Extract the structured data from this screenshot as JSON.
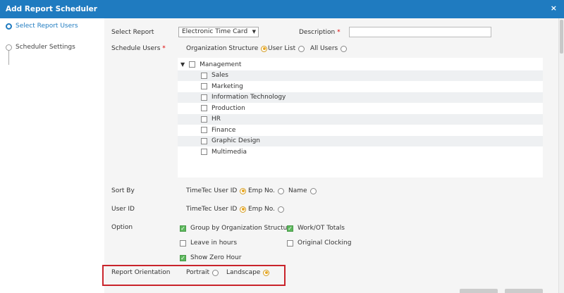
{
  "dialog": {
    "title": "Add Report Scheduler",
    "close": "×"
  },
  "steps": [
    {
      "label": "Select Report Users",
      "active": true
    },
    {
      "label": "Scheduler Settings",
      "active": false
    }
  ],
  "form": {
    "select_report": {
      "label": "Select Report",
      "value": "Electronic Time Card"
    },
    "description": {
      "label": "Description",
      "required_mark": "*",
      "value": ""
    },
    "schedule_users": {
      "label": "Schedule Users",
      "required_mark": "*",
      "options": [
        {
          "label": "Organization Structure",
          "selected": true
        },
        {
          "label": "User List",
          "selected": false
        },
        {
          "label": "All Users",
          "selected": false
        }
      ]
    },
    "tree": {
      "root": {
        "label": "Management",
        "checked": false
      },
      "children": [
        {
          "label": "Sales",
          "checked": false
        },
        {
          "label": "Marketing",
          "checked": false
        },
        {
          "label": "Information Technology",
          "checked": false
        },
        {
          "label": "Production",
          "checked": false
        },
        {
          "label": "HR",
          "checked": false
        },
        {
          "label": "Finance",
          "checked": false
        },
        {
          "label": "Graphic Design",
          "checked": false
        },
        {
          "label": "Multimedia",
          "checked": false
        }
      ]
    },
    "sort_by": {
      "label": "Sort By",
      "options": [
        {
          "label": "TimeTec User ID",
          "selected": true
        },
        {
          "label": "Emp No.",
          "selected": false
        },
        {
          "label": "Name",
          "selected": false
        }
      ]
    },
    "user_id": {
      "label": "User ID",
      "options": [
        {
          "label": "TimeTec User ID",
          "selected": true
        },
        {
          "label": "Emp No.",
          "selected": false
        }
      ]
    },
    "option": {
      "label": "Option",
      "items": [
        {
          "label": "Group by Organization Structure",
          "checked": true
        },
        {
          "label": "Work/OT Totals",
          "checked": true
        },
        {
          "label": "Leave in hours",
          "checked": false
        },
        {
          "label": "Original Clocking",
          "checked": false
        },
        {
          "label": "Show Zero Hour",
          "checked": true
        }
      ]
    },
    "report_orientation": {
      "label": "Report Orientation",
      "options": [
        {
          "label": "Portrait",
          "selected": false
        },
        {
          "label": "Landscape",
          "selected": true
        }
      ]
    }
  },
  "colors": {
    "accent": "#1f7bc0",
    "radio_selected": "#e8a823",
    "checkbox_checked": "#5cb85c",
    "highlight": "#c9242b"
  }
}
